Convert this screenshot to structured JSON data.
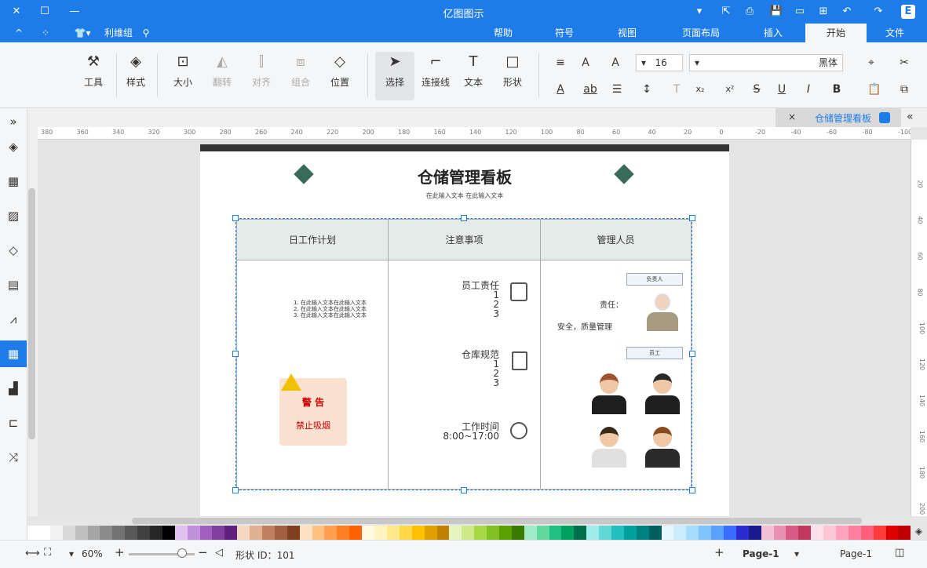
{
  "title": "亿图图示",
  "menu_tabs": [
    {
      "label": "文件"
    },
    {
      "label": "开始"
    },
    {
      "label": "插入"
    },
    {
      "label": "页面布局"
    },
    {
      "label": "视图"
    },
    {
      "label": "符号"
    },
    {
      "label": "帮助"
    }
  ],
  "menubar_left": {
    "bullet_label": "利维组"
  },
  "ribbon": {
    "font_name": "黑体",
    "font_size": "16",
    "buttons": {
      "tools": "工具",
      "style": "样式",
      "size": "大小",
      "flip": "翻转",
      "align": "对齐",
      "group": "组合",
      "position": "位置",
      "select": "选择",
      "connector": "连接线",
      "text": "文本",
      "shape": "形状"
    },
    "format_glyphs": {
      "bold": "B",
      "italic": "I",
      "underline": "U",
      "strike": "S",
      "sup": "x²",
      "sub": "x₂",
      "clear": "X",
      "text_t": "T",
      "font_a": "A",
      "ab": "ab"
    }
  },
  "doc_tab": {
    "label": "仓储管理看板",
    "close": "×"
  },
  "rulers": {
    "h": [
      "380",
      "360",
      "340",
      "320",
      "300",
      "280",
      "260",
      "240",
      "220",
      "200",
      "180",
      "160",
      "140",
      "120",
      "100",
      "80",
      "60",
      "40",
      "20",
      "0",
      "-20",
      "-40",
      "-60",
      "-80",
      "-100"
    ],
    "v": [
      "20",
      "40",
      "60",
      "80",
      "100",
      "120",
      "140",
      "160",
      "180",
      "200"
    ]
  },
  "board": {
    "title": "仓储管理看板",
    "subtitle": "在此输入文本 在此输入文本",
    "columns": [
      "管理人员",
      "注意事项",
      "日工作计划"
    ],
    "manager": {
      "tag1": "负责人",
      "duty_label": "责任：",
      "duty_value": "安全，质量管理",
      "tag2": "员工"
    },
    "notes": {
      "item1_title": "员工责任",
      "item1_lines": [
        "1",
        "2",
        "3"
      ],
      "item2_title": "仓库规范",
      "item2_lines": [
        "1",
        "2",
        "3"
      ],
      "item3_title": "工作时间",
      "item3_value": "8:00~17:00"
    },
    "plan": {
      "lines": [
        "1. 在此输入文本在此输入文本",
        "2. 在此输入文本在此输入文本",
        "3. 在此输入文本在此输入文本"
      ],
      "warn_text": "警    告",
      "warn_sub": "禁止吸烟"
    }
  },
  "palette": [
    "#c00000",
    "#e00000",
    "#ff3b3b",
    "#ff5f7a",
    "#ff7fa0",
    "#ffa3c0",
    "#ffc6d8",
    "#ffe0ea",
    "#c0395f",
    "#d95a85",
    "#e890b0",
    "#f5c0d5",
    "#1a1a8c",
    "#2b2bd0",
    "#3a6cff",
    "#5aa0ff",
    "#7fc4ff",
    "#a8dcff",
    "#c9ecff",
    "#e5f6ff",
    "#006060",
    "#008080",
    "#00a0a0",
    "#20c0c0",
    "#60d8d8",
    "#a0ecec",
    "#00704a",
    "#00a060",
    "#20c080",
    "#60d8a0",
    "#a0ecc8",
    "#3a7a00",
    "#5aa000",
    "#80c020",
    "#a8d848",
    "#cfe888",
    "#e8f4c0",
    "#c08000",
    "#e0a000",
    "#ffc000",
    "#ffd84a",
    "#ffe88a",
    "#fff4c0",
    "#fffae0",
    "#ff6000",
    "#ff8020",
    "#ffa050",
    "#ffc080",
    "#ffe0c0",
    "#804020",
    "#a06040",
    "#c08060",
    "#e0b090",
    "#f4d8c0",
    "#602080",
    "#8040a0",
    "#a060c0",
    "#c090d8",
    "#e0c0ec",
    "#000000",
    "#262626",
    "#404040",
    "#595959",
    "#737373",
    "#8c8c8c",
    "#a6a6a6",
    "#bfbfbf",
    "#d9d9d9",
    "#f2f2f2",
    "#ffffff"
  ],
  "status": {
    "page_name": "Page-1",
    "page_tab": "Page-1",
    "shape_id": "形状 ID：101",
    "zoom": "60%"
  }
}
